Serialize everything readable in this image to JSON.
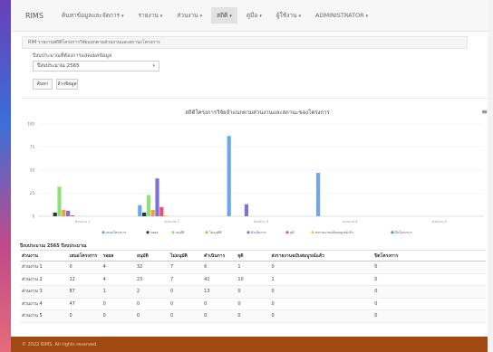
{
  "app": {
    "brand": "RIMS"
  },
  "nav": {
    "items": [
      {
        "label": "ค้นหาข้อมูลและจัดการ"
      },
      {
        "label": "รายงาน"
      },
      {
        "label": "ส่วนงาน"
      },
      {
        "label": "สถิติ"
      },
      {
        "label": "คู่มือ"
      },
      {
        "label": "ผู้ใช้งาน"
      },
      {
        "label": "ADMINISTRATOR"
      }
    ]
  },
  "breadcrumb": {
    "text": "RIM รายงานสถิติโครงการวิจัยแยกตามส่วนงานและสถานะโครงการ"
  },
  "filter": {
    "label": "ปีงบประมาณที่ต้องการแสดงผลข้อมูล",
    "selected_year": "ปีงบประมาณ 2565",
    "search_label": "ค้นหา",
    "reset_label": "ล้างข้อมูล"
  },
  "chart_data": {
    "type": "bar",
    "title": "สถิติโครงการวิจัยจำแนกตามส่วนงานและสถานะของโครงการ",
    "categories": [
      "ส่วนงาน 1",
      "ส่วนงาน 2",
      "ส่วนงาน 3",
      "ส่วนงาน 4",
      "ส่วนงาน 5"
    ],
    "ylim": [
      0,
      100
    ],
    "yticks": [
      0,
      25,
      50,
      75,
      100
    ],
    "series": [
      {
        "name": "เสนอโครงการ",
        "color": "#6aa8e8",
        "values": [
          0,
          12,
          87,
          47,
          0
        ]
      },
      {
        "name": "รอผล",
        "color": "#333333",
        "values": [
          4,
          4,
          0,
          0,
          0
        ]
      },
      {
        "name": "อนุมัติ",
        "color": "#8fe07a",
        "values": [
          32,
          23,
          0,
          0,
          0
        ]
      },
      {
        "name": "ไม่อนุมัติ",
        "color": "#f0a040",
        "values": [
          7,
          7,
          0,
          0,
          0
        ]
      },
      {
        "name": "ดำเนินการ",
        "color": "#8070d8",
        "values": [
          6,
          41,
          13,
          0,
          0
        ]
      },
      {
        "name": "ยุติ",
        "color": "#e85070",
        "values": [
          1,
          10,
          0,
          0,
          0
        ]
      },
      {
        "name": "ส่งรายงานฉบับสมบูรณ์แล้ว",
        "color": "#e8d040",
        "values": [
          0,
          1,
          0,
          0,
          0
        ]
      },
      {
        "name": "ปิดโครงการ",
        "color": "#2aa8a0",
        "values": [
          0,
          0,
          0,
          0,
          0
        ]
      }
    ],
    "legend_position": "bottom"
  },
  "table": {
    "caption": "ปีงบประมาณ 2565 ปีงบประมาณ",
    "headers": [
      "ส่วนงาน",
      "เสนอโครงการ",
      "รอผล",
      "อนุมัติ",
      "ไม่อนุมัติ",
      "ดำเนินการ",
      "ยุติ",
      "ส่งรายงานฉบับสมบูรณ์แล้ว",
      "ปิดโครงการ"
    ],
    "rows": [
      [
        "ส่วนงาน 1",
        "0",
        "4",
        "32",
        "7",
        "6",
        "1",
        "0",
        "0"
      ],
      [
        "ส่วนงาน 2",
        "12",
        "4",
        "23",
        "7",
        "41",
        "10",
        "1",
        "0"
      ],
      [
        "ส่วนงาน 3",
        "87",
        "1",
        "2",
        "0",
        "13",
        "0",
        "0",
        "0"
      ],
      [
        "ส่วนงาน 4",
        "47",
        "0",
        "0",
        "0",
        "0",
        "0",
        "0",
        "0"
      ],
      [
        "ส่วนงาน 5",
        "0",
        "0",
        "0",
        "0",
        "0",
        "0",
        "0",
        "0"
      ]
    ]
  },
  "footer": {
    "text": "© 2022 RIMS. All rights reserved."
  }
}
